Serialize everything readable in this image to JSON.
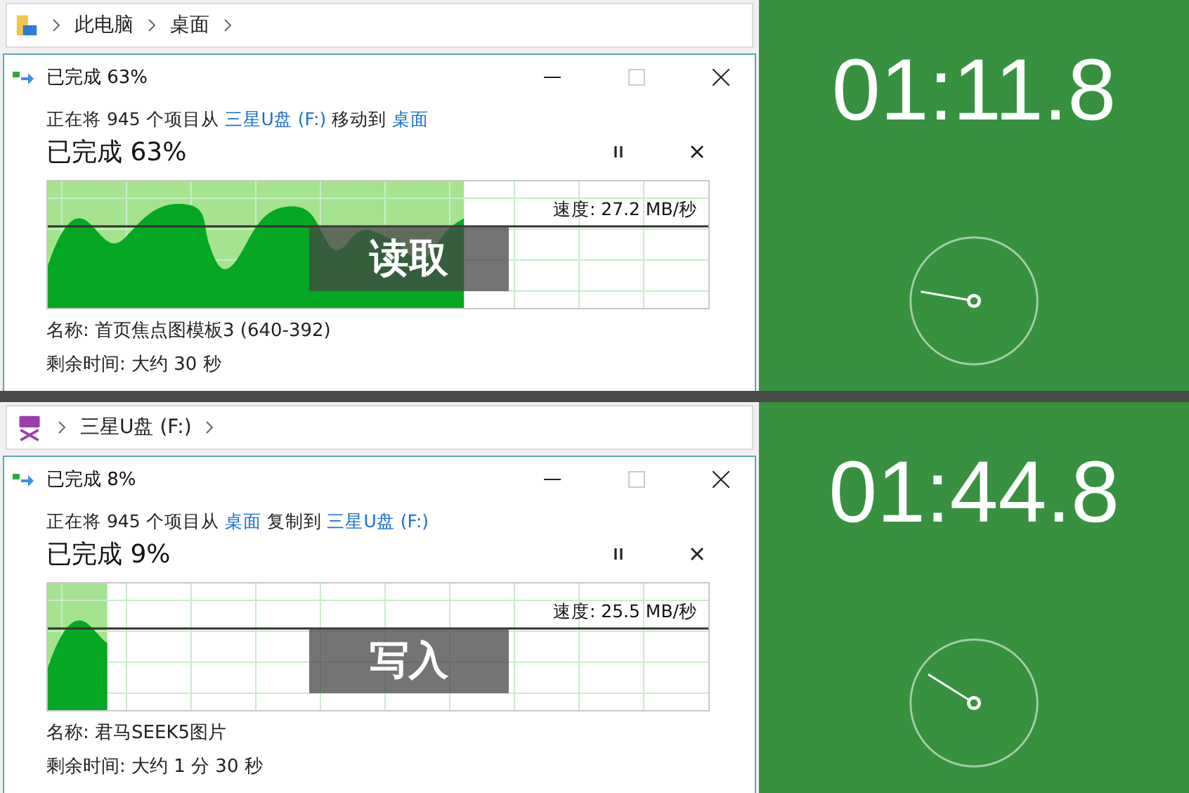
{
  "panels": [
    {
      "address_bar": {
        "kind": "folder",
        "crumbs": [
          "此电脑",
          "桌面"
        ]
      },
      "dialog": {
        "title": "已完成 63%",
        "description": [
          {
            "text": "正在将 945 个项目从 ",
            "link": false
          },
          {
            "text": "三星U盘 (F:)",
            "link": true
          },
          {
            "text": " 移动到 ",
            "link": false
          },
          {
            "text": "桌面",
            "link": true
          }
        ],
        "status": "已完成 63%",
        "level": 0.63,
        "speed": "速度: 27.2 MB/秒",
        "overlay": "读取",
        "name": "名称: 首页焦点图模板3 (640-392)",
        "remaining": "剩余时间: 大约 30 秒"
      },
      "timer": {
        "time": "01:11.8"
      }
    },
    {
      "address_bar": {
        "kind": "sd-card",
        "crumbs": [
          "三星U盘 (F:)"
        ]
      },
      "dialog": {
        "title": "已完成 8%",
        "description": [
          {
            "text": "正在将 945 个项目从 ",
            "link": false
          },
          {
            "text": "桌面",
            "link": true
          },
          {
            "text": " 复制到 ",
            "link": false
          },
          {
            "text": "三星U盘 (F:)",
            "link": true
          }
        ],
        "status": "已完成 9%",
        "level": 0.09,
        "speed": "速度: 25.5 MB/秒",
        "overlay": "写入",
        "name": "名称: 君马SEEK5图片",
        "remaining": "剩余时间: 大约 1 分 30 秒"
      },
      "timer": {
        "time": "01:44.8"
      }
    }
  ]
}
